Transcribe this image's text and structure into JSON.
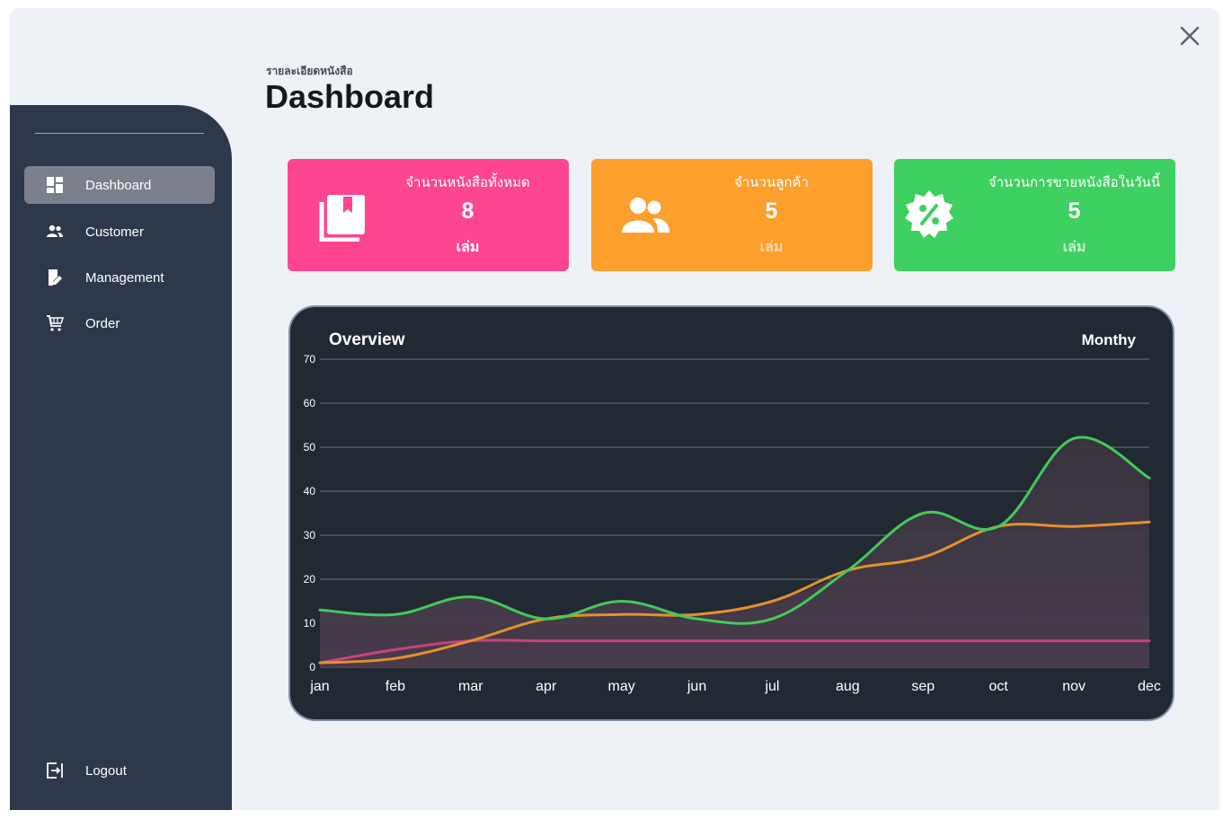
{
  "colors": {
    "window_bg": "#eef1f6",
    "sidebar_bg": "#2e384b",
    "active_item_bg": "#7a7f8b",
    "card_books": "#fd4590",
    "card_customers": "#fd9f2c",
    "card_sales": "#3ed061",
    "chart_bg": "#212933"
  },
  "header": {
    "subtitle": "รายละเอียดหนังสือ",
    "title": "Dashboard"
  },
  "sidebar": {
    "items": [
      {
        "label": "Dashboard",
        "icon": "dashboard-icon",
        "active": true
      },
      {
        "label": "Customer",
        "icon": "users-icon",
        "active": false
      },
      {
        "label": "Management",
        "icon": "book-edit-icon",
        "active": false
      },
      {
        "label": "Order",
        "icon": "cart-icon",
        "active": false
      }
    ],
    "logout": {
      "label": "Logout",
      "icon": "logout-icon"
    }
  },
  "cards": [
    {
      "title": "จำนวนหนังสือทั้งหมด",
      "value": "8",
      "unit": "เล่ม",
      "icon": "book-icon",
      "color": "#fd4590"
    },
    {
      "title": "จำนวนลูกค้า",
      "value": "5",
      "unit": "เล่ม",
      "icon": "users-icon",
      "color": "#fd9f2c"
    },
    {
      "title": "จำนวนการขายหนังสือในวันนี้",
      "value": "5",
      "unit": "เล่ม",
      "icon": "discount-badge-icon",
      "color": "#3ed061"
    }
  ],
  "chart_data": {
    "type": "line",
    "title": "Overview",
    "period": "Monthy",
    "categories": [
      "jan",
      "feb",
      "mar",
      "apr",
      "may",
      "jun",
      "jul",
      "aug",
      "sep",
      "oct",
      "nov",
      "dec"
    ],
    "ylim": [
      0,
      70
    ],
    "yticks": [
      "0",
      "10",
      "20",
      "30",
      "40",
      "50",
      "60",
      "70"
    ],
    "grid": true,
    "series": [
      {
        "color": "#43c95a",
        "values": [
          13,
          12,
          16,
          11,
          15,
          11,
          11,
          22,
          35,
          32,
          52,
          43
        ]
      },
      {
        "color": "#e2902e",
        "values": [
          1,
          2,
          6,
          11,
          12,
          12,
          15,
          22,
          25,
          32,
          32,
          33
        ]
      },
      {
        "color": "#c8427d",
        "values": [
          1,
          4,
          6,
          6,
          6,
          6,
          6,
          6,
          6,
          6,
          6,
          6
        ]
      }
    ]
  }
}
